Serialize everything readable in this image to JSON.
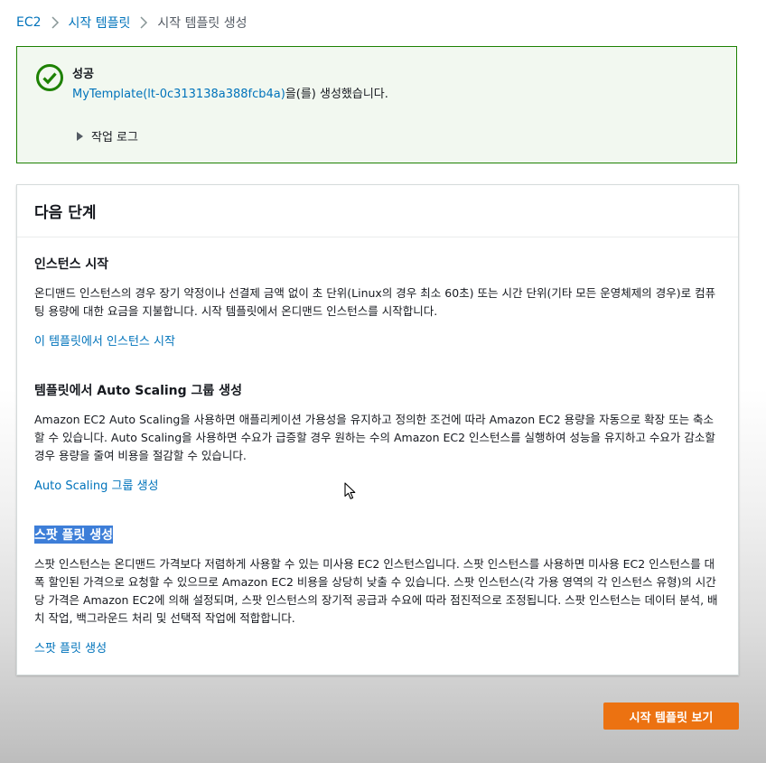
{
  "breadcrumb": {
    "items": [
      "EC2",
      "시작 템플릿",
      "시작 템플릿 생성"
    ]
  },
  "flash": {
    "type": "success",
    "title": "성공",
    "template_link": "MyTemplate(lt-0c313138a388fcb4a)",
    "message_suffix": "을(를) 생성했습니다.",
    "log_toggle": "작업 로그",
    "icon": "check-circle-icon"
  },
  "next_steps": {
    "title": "다음 단계",
    "sections": [
      {
        "title": "인스턴스 시작",
        "description": "온디맨드 인스턴스의 경우 장기 약정이나 선결제 금액 없이 초 단위(Linux의 경우 최소 60초) 또는 시간 단위(기타 모든 운영체제의 경우)로 컴퓨팅 용량에 대한 요금을 지불합니다. 시작 템플릿에서 온디맨드 인스턴스를 시작합니다.",
        "link": "이 템플릿에서 인스턴스 시작"
      },
      {
        "title": "템플릿에서 Auto Scaling 그룹 생성",
        "description": "Amazon EC2 Auto Scaling을 사용하면 애플리케이션 가용성을 유지하고 정의한 조건에 따라 Amazon EC2 용량을 자동으로 확장 또는 축소할 수 있습니다. Auto Scaling을 사용하면 수요가 급증할 경우 원하는 수의 Amazon EC2 인스턴스를 실행하여 성능을 유지하고 수요가 감소할 경우 용량을 줄여 비용을 절감할 수 있습니다.",
        "link": "Auto Scaling 그룹 생성"
      },
      {
        "title": "스팟 플릿 생성",
        "description": "스팟 인스턴스는 온디맨드 가격보다 저렴하게 사용할 수 있는 미사용 EC2 인스턴스입니다. 스팟 인스턴스를 사용하면 미사용 EC2 인스턴스를 대폭 할인된 가격으로 요청할 수 있으므로 Amazon EC2 비용을 상당히 낮출 수 있습니다. 스팟 인스턴스(각 가용 영역의 각 인스턴스 유형)의 시간당 가격은 Amazon EC2에 의해 설정되며, 스팟 인스턴스의 장기적 공급과 수요에 따라 점진적으로 조정됩니다. 스팟 인스턴스는 데이터 분석, 배치 작업, 백그라운드 처리 및 선택적 작업에 적합합니다.",
        "link": "스팟 플릿 생성"
      }
    ]
  },
  "primary_button": "시작 템플릿 보기",
  "colors": {
    "link": "#0073bb",
    "success": "#1d8102",
    "primary": "#ec7211",
    "selection": "#3d7ed8"
  }
}
